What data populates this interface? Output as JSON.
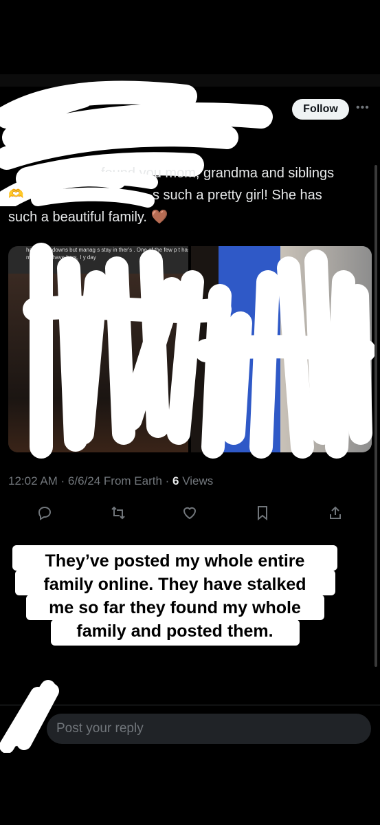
{
  "header": {
    "follow_label": "Follow",
    "more_icon": "more-horizontal-icon"
  },
  "tweet": {
    "text_line1": "found you mom, grandma and siblings",
    "text_line2": "s such a pretty girl! She has",
    "text_line3": "such a beautiful family. 🤎",
    "emoji_left": "🫶",
    "media_left_caption": "had u    and downs but manag    s stay in  ther's   . One of the few p    t has my   all t    d I have hers, I    y day",
    "timestamp": "12:02 AM · 6/6/24 From Earth · ",
    "views_count": "6",
    "views_label": " Views"
  },
  "actions": {
    "reply_icon": "reply-icon",
    "retweet_icon": "retweet-icon",
    "like_icon": "heart-icon",
    "bookmark_icon": "bookmark-icon",
    "share_icon": "share-icon"
  },
  "callout": {
    "line1": "They’ve posted my whole entire",
    "line2": "family online. They have stalked",
    "line3": "me so far they found my whole",
    "line4": "family and posted them."
  },
  "reply": {
    "placeholder": "Post your reply"
  },
  "colors": {
    "background": "#000000",
    "muted_text": "#71767b",
    "primary_text": "#e7e9ea",
    "follow_bg": "#eff3f4",
    "input_bg": "#202327"
  }
}
